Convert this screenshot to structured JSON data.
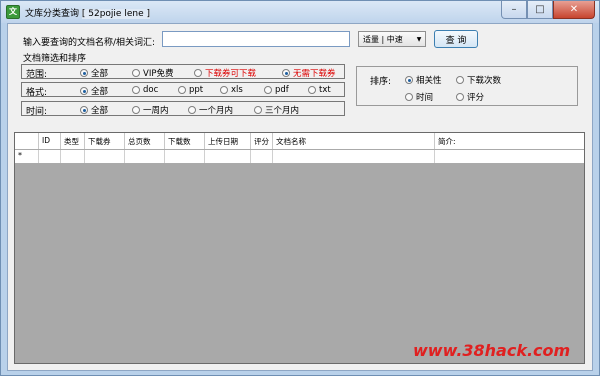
{
  "window": {
    "title": "文库分类查询",
    "title_tag": "[ 52pojie lene ]",
    "app_icon": "文",
    "minimize": "–",
    "maximize": "□",
    "close": "✕"
  },
  "search": {
    "label": "输入要查询的文档名称/相关词汇:",
    "value": "",
    "placeholder": "",
    "select_value": "适量 | 中速",
    "select_arrow": "▼",
    "button": "查 询"
  },
  "filter": {
    "section_label": "文档筛选和排序",
    "scope": {
      "label": "范围:",
      "options": [
        {
          "text": "全部",
          "selected": true
        },
        {
          "text": "VIP免费",
          "selected": false
        },
        {
          "text": "下载券可下载",
          "selected": false
        },
        {
          "text": "无需下载券",
          "selected": true
        }
      ]
    },
    "format": {
      "label": "格式:",
      "options": [
        {
          "text": "全部",
          "selected": true
        },
        {
          "text": "doc",
          "selected": false
        },
        {
          "text": "ppt",
          "selected": false
        },
        {
          "text": "xls",
          "selected": false
        },
        {
          "text": "pdf",
          "selected": false
        },
        {
          "text": "txt",
          "selected": false
        }
      ]
    },
    "time": {
      "label": "时间:",
      "options": [
        {
          "text": "全部",
          "selected": true
        },
        {
          "text": "一周内",
          "selected": false
        },
        {
          "text": "一个月内",
          "selected": false
        },
        {
          "text": "三个月内",
          "selected": false
        }
      ]
    }
  },
  "sort": {
    "label": "排序:",
    "options": [
      {
        "text": "相关性",
        "selected": true
      },
      {
        "text": "下载次数",
        "selected": false
      },
      {
        "text": "时间",
        "selected": false
      },
      {
        "text": "评分",
        "selected": false
      }
    ]
  },
  "grid": {
    "columns": [
      "ID",
      "类型",
      "下载券",
      "总页数",
      "下载数",
      "上传日期",
      "评分",
      "文档名称",
      "简介:"
    ],
    "new_row_marker": "*"
  },
  "watermark": "www.38hack.com",
  "colors": {
    "accent_red": "#d00000",
    "grid_background": "#a9a9a9",
    "window_frame": "#b9d1ea"
  }
}
